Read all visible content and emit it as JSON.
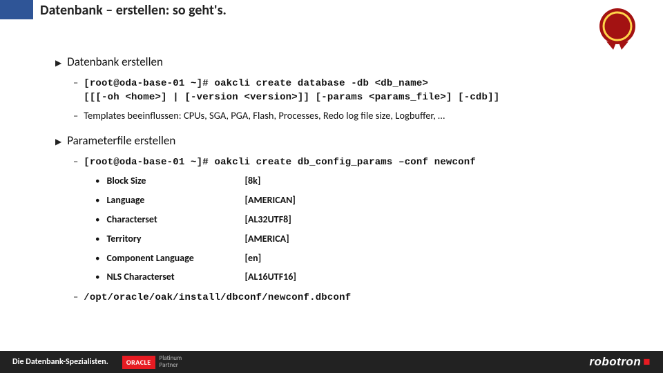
{
  "header": {
    "title": "Datenbank – erstellen: so geht's.",
    "badge_alt": "Oracle Engineered Systems Focus Partner"
  },
  "section1": {
    "heading": "Datenbank erstellen",
    "cmd_line1": "[root@oda-base-01 ~]# oakcli create database  -db <db_name>",
    "cmd_line2": "[[[-oh <home>] | [-version <version>]]  [-params <params_file>] [-cdb]]",
    "templates_note": "Templates beeinflussen: CPUs, SGA, PGA, Flash, Processes, Redo log file size, Logbuffer, …"
  },
  "section2": {
    "heading": "Parameterfile erstellen",
    "cmd": "[root@oda-base-01 ~]# oakcli create db_config_params –conf newconf",
    "params": [
      {
        "name": "Block Size",
        "value": "[8k]"
      },
      {
        "name": "Language",
        "value": "[AMERICAN]"
      },
      {
        "name": "Characterset",
        "value": "[AL32UTF8]"
      },
      {
        "name": "Territory",
        "value": "[AMERICA]"
      },
      {
        "name": "Component Language",
        "value": "[en]"
      },
      {
        "name": "NLS Characterset",
        "value": "[AL16UTF16]"
      }
    ],
    "path": "/opt/oracle/oak/install/dbconf/newconf.dbconf"
  },
  "footer": {
    "tagline": "Die Datenbank-Spezialisten.",
    "oracle_brand": "ORACLE",
    "oracle_line1": "Platinum",
    "oracle_line2": "Partner",
    "brand": "robotron"
  }
}
